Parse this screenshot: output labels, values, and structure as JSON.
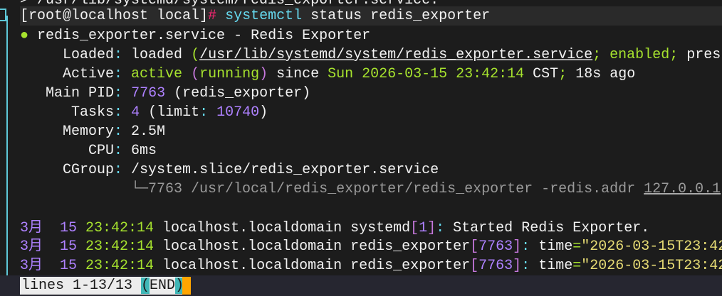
{
  "terminal": {
    "lines": [
      {
        "kind": "partial",
        "segs": [
          [
            "> /usr/lib/systemd/system/redis_exporter.service.",
            "w"
          ]
        ]
      },
      {
        "kind": "prompt",
        "segs": [
          [
            "[root@localhost local]",
            "w"
          ],
          [
            "#",
            "pk"
          ],
          [
            " ",
            "w"
          ],
          [
            "systemctl",
            "cy"
          ],
          [
            " status redis_exporter",
            "w"
          ]
        ]
      },
      {
        "segs": [
          [
            "●",
            "g"
          ],
          [
            " redis_exporter.service - Redis Exporter",
            "w"
          ]
        ]
      },
      {
        "segs": [
          [
            "     Loaded",
            "w"
          ],
          [
            ":",
            "cy"
          ],
          [
            " loaded ",
            "w"
          ],
          [
            "(",
            "g"
          ],
          [
            "/usr/lib/systemd/system/redis_exporter.service",
            "wu"
          ],
          [
            "; enabled; ",
            "g"
          ],
          [
            "pres",
            "w"
          ]
        ]
      },
      {
        "segs": [
          [
            "     Active",
            "w"
          ],
          [
            ":",
            "cy"
          ],
          [
            " active ",
            "g"
          ],
          [
            "(",
            "m"
          ],
          [
            "running",
            "g"
          ],
          [
            ")",
            "m"
          ],
          [
            " since ",
            "w"
          ],
          [
            "Sun 2026-03-15 23:42:14",
            "g"
          ],
          [
            " CST",
            "w"
          ],
          [
            ";",
            "g"
          ],
          [
            " 18s ago",
            "w"
          ]
        ]
      },
      {
        "segs": [
          [
            "   Main PID",
            "w"
          ],
          [
            ":",
            "cy"
          ],
          [
            " ",
            "w"
          ],
          [
            "7763",
            "p"
          ],
          [
            " (redis_exporter)",
            "w"
          ]
        ]
      },
      {
        "segs": [
          [
            "      Tasks",
            "w"
          ],
          [
            ":",
            "cy"
          ],
          [
            " ",
            "w"
          ],
          [
            "4",
            "p"
          ],
          [
            " (limit",
            "w"
          ],
          [
            ":",
            "cy"
          ],
          [
            " ",
            "w"
          ],
          [
            "10740",
            "p"
          ],
          [
            ")",
            "w"
          ]
        ]
      },
      {
        "segs": [
          [
            "     Memory",
            "w"
          ],
          [
            ":",
            "cy"
          ],
          [
            " 2.5M",
            "w"
          ]
        ]
      },
      {
        "segs": [
          [
            "        CPU",
            "w"
          ],
          [
            ":",
            "cy"
          ],
          [
            " 6ms",
            "w"
          ]
        ]
      },
      {
        "segs": [
          [
            "     CGroup",
            "w"
          ],
          [
            ":",
            "cy"
          ],
          [
            " /system.slice/redis_exporter.service",
            "w"
          ]
        ]
      },
      {
        "segs": [
          [
            "             └─7763 /usr/local/redis_exporter/redis_exporter -redis.addr ",
            "gr"
          ],
          [
            "127.0.0.1",
            "gru"
          ]
        ]
      },
      {
        "segs": [
          [
            "",
            "w"
          ]
        ]
      },
      {
        "segs": [
          [
            "3月 ",
            "p"
          ],
          [
            " 15 ",
            "p"
          ],
          [
            "23:42:14",
            "g"
          ],
          [
            " localhost.localdomain systemd",
            "w"
          ],
          [
            "[",
            "m"
          ],
          [
            "1",
            "p"
          ],
          [
            "]",
            "m"
          ],
          [
            ":",
            "cy"
          ],
          [
            " Started Redis Exporter.",
            "w"
          ]
        ]
      },
      {
        "segs": [
          [
            "3月 ",
            "p"
          ],
          [
            " 15 ",
            "p"
          ],
          [
            "23:42:14",
            "g"
          ],
          [
            " localhost.localdomain redis_exporter",
            "w"
          ],
          [
            "[",
            "m"
          ],
          [
            "7763",
            "p"
          ],
          [
            "]",
            "m"
          ],
          [
            ":",
            "cy"
          ],
          [
            " time",
            "w"
          ],
          [
            "=",
            "g"
          ],
          [
            "\"2026-03-15T23:42",
            "y"
          ]
        ]
      },
      {
        "segs": [
          [
            "3月 ",
            "p"
          ],
          [
            " 15 ",
            "p"
          ],
          [
            "23:42:14",
            "g"
          ],
          [
            " localhost.localdomain redis_exporter",
            "w"
          ],
          [
            "[",
            "m"
          ],
          [
            "7763",
            "p"
          ],
          [
            "]",
            "m"
          ],
          [
            ":",
            "cy"
          ],
          [
            " time",
            "w"
          ],
          [
            "=",
            "g"
          ],
          [
            "\"2026-03-15T23:42",
            "y"
          ]
        ]
      }
    ]
  },
  "pager": {
    "lines_label": "lines 1-13/13 ",
    "open_paren": "(",
    "end_label": "END",
    "close_paren": ")"
  },
  "colors": {
    "green": "#a6e22e",
    "purple": "#ae81ff",
    "pink": "#f92672",
    "cyan": "#66d9ef",
    "yellow": "#e6db74",
    "cursor": "#ffa500"
  }
}
